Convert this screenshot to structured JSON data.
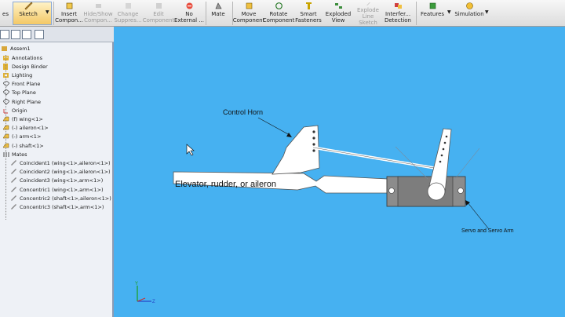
{
  "toolbar": {
    "items": [
      {
        "label1": "es",
        "label2": ""
      },
      {
        "label1": "Sketch",
        "label2": ""
      },
      {
        "label1": "Insert",
        "label2": "Compon..."
      },
      {
        "label1": "Hide/Show",
        "label2": "Compon..."
      },
      {
        "label1": "Change",
        "label2": "Suppres..."
      },
      {
        "label1": "Edit",
        "label2": "Component"
      },
      {
        "label1": "No",
        "label2": "External ..."
      },
      {
        "label1": "Mate",
        "label2": ""
      },
      {
        "label1": "Move",
        "label2": "Component"
      },
      {
        "label1": "Rotate",
        "label2": "Component"
      },
      {
        "label1": "Smart",
        "label2": "Fasteners"
      },
      {
        "label1": "Exploded",
        "label2": "View"
      },
      {
        "label1": "Explode",
        "label2": "Line Sketch"
      },
      {
        "label1": "Interfer...",
        "label2": "Detection"
      },
      {
        "label1": "Features",
        "label2": ""
      },
      {
        "label1": "Simulation",
        "label2": ""
      }
    ]
  },
  "tree": {
    "root": "Assem1",
    "items": [
      {
        "label": "Annotations",
        "icon": "annotations-icon"
      },
      {
        "label": "Design Binder",
        "icon": "design-binder-icon"
      },
      {
        "label": "Lighting",
        "icon": "lighting-icon"
      },
      {
        "label": "Front Plane",
        "icon": "plane-icon"
      },
      {
        "label": "Top Plane",
        "icon": "plane-icon"
      },
      {
        "label": "Right Plane",
        "icon": "plane-icon"
      },
      {
        "label": "Origin",
        "icon": "origin-icon"
      },
      {
        "label": "(f) wing<1>",
        "icon": "part-icon"
      },
      {
        "label": "(-) aileron<1>",
        "icon": "part-icon"
      },
      {
        "label": "(-) arm<1>",
        "icon": "part-icon"
      },
      {
        "label": "(-) shaft<1>",
        "icon": "part-icon"
      },
      {
        "label": "Mates",
        "icon": "mates-icon"
      },
      {
        "label": "Coincident1 (wing<1>,aileron<1>)",
        "icon": "mate-icon"
      },
      {
        "label": "Coincident2 (wing<1>,aileron<1>)",
        "icon": "mate-icon"
      },
      {
        "label": "Coincident3 (wing<1>,arm<1>)",
        "icon": "mate-icon"
      },
      {
        "label": "Concentric1 (wing<1>,arm<1>)",
        "icon": "mate-icon"
      },
      {
        "label": "Concentric2 (shaft<1>,aileron<1>)",
        "icon": "mate-icon"
      },
      {
        "label": "Concentric3 (shaft<1>,arm<1>)",
        "icon": "mate-icon"
      }
    ]
  },
  "canvas": {
    "labels": {
      "control_horn": "Control Horn",
      "elevator": "Elevator, rudder, or aileron",
      "servo": "Servo and Servo Arm"
    }
  },
  "colors": {
    "background": "#46b1f1",
    "toolbar": "#e6e6e6",
    "panel": "#eef1f6",
    "servo_body": "#8c8c8c"
  }
}
